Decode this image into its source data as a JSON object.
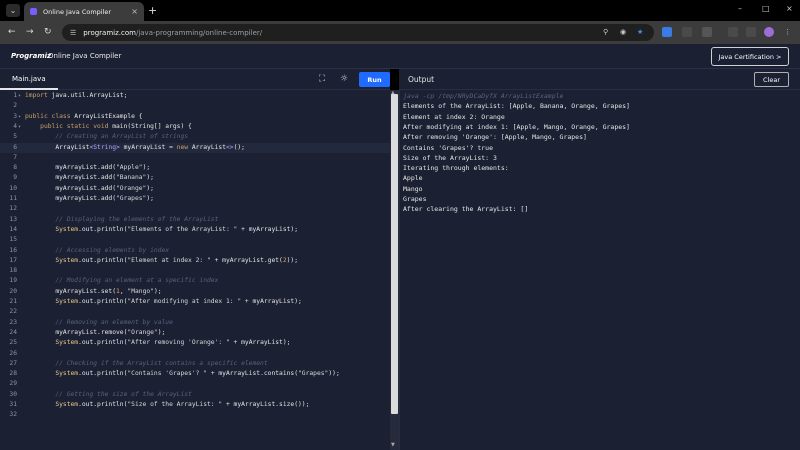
{
  "browser": {
    "tab_title": "Online Java Compiler",
    "url_host": "programiz.com",
    "url_path": "/java-programming/online-compiler/"
  },
  "site": {
    "logo_text": "Programiz",
    "title": "Online Java Compiler",
    "cert_button": "Java Certification >"
  },
  "editor": {
    "file_tab": "Main.java",
    "run_label": "Run",
    "active_line": 6,
    "lines": [
      {
        "n": "1",
        "fold": "▾",
        "html": "<span class=\"kw\">import</span> <span class=\"pl\">java.util.ArrayList;</span>"
      },
      {
        "n": "2",
        "fold": "",
        "html": ""
      },
      {
        "n": "3",
        "fold": "▾",
        "html": "<span class=\"kw\">public class</span> <span class=\"pl\">ArrayListExample {</span>"
      },
      {
        "n": "4",
        "fold": "▾",
        "html": "    <span class=\"kw\">public static void</span> <span class=\"fn\">main</span><span class=\"pl\">(String[] args) {</span>"
      },
      {
        "n": "5",
        "fold": "",
        "html": "        <span class=\"cm\">// Creating an ArrayList of strings</span>"
      },
      {
        "n": "6",
        "fold": "",
        "html": "        <span class=\"pl\">ArrayList</span><span class=\"ty\">&lt;String&gt;</span> <span class=\"pl\">myArrayList = </span><span class=\"kw\">new</span> <span class=\"pl\">ArrayList</span><span class=\"ty\">&lt;&gt;</span><span class=\"pl\">();</span>"
      },
      {
        "n": "7",
        "fold": "",
        "html": ""
      },
      {
        "n": "8",
        "fold": "",
        "html": "        <span class=\"pl\">myArrayList.add(</span><span class=\"str\">\"Apple\"</span><span class=\"pl\">);</span>"
      },
      {
        "n": "9",
        "fold": "",
        "html": "        <span class=\"pl\">myArrayList.add(</span><span class=\"str\">\"Banana\"</span><span class=\"pl\">);</span>"
      },
      {
        "n": "10",
        "fold": "",
        "html": "        <span class=\"pl\">myArrayList.add(</span><span class=\"str\">\"Orange\"</span><span class=\"pl\">);</span>"
      },
      {
        "n": "11",
        "fold": "",
        "html": "        <span class=\"pl\">myArrayList.add(</span><span class=\"str\">\"Grapes\"</span><span class=\"pl\">);</span>"
      },
      {
        "n": "12",
        "fold": "",
        "html": ""
      },
      {
        "n": "13",
        "fold": "",
        "html": "        <span class=\"cm\">// Displaying the elements of the ArrayList</span>"
      },
      {
        "n": "14",
        "fold": "",
        "html": "        <span class=\"sysout\">System</span><span class=\"pl\">.out.println(</span><span class=\"str\">\"Elements of the ArrayList: \"</span> <span class=\"pl\">+ myArrayList);</span>"
      },
      {
        "n": "15",
        "fold": "",
        "html": ""
      },
      {
        "n": "16",
        "fold": "",
        "html": "        <span class=\"cm\">// Accessing elements by index</span>"
      },
      {
        "n": "17",
        "fold": "",
        "html": "        <span class=\"sysout\">System</span><span class=\"pl\">.out.println(</span><span class=\"str\">\"Element at index 2: \"</span> <span class=\"pl\">+ myArrayList.get(</span><span class=\"num\">2</span><span class=\"pl\">));</span>"
      },
      {
        "n": "18",
        "fold": "",
        "html": ""
      },
      {
        "n": "19",
        "fold": "",
        "html": "        <span class=\"cm\">// Modifying an element at a specific index</span>"
      },
      {
        "n": "20",
        "fold": "",
        "html": "        <span class=\"pl\">myArrayList.set(</span><span class=\"num\">1</span><span class=\"pl\">, </span><span class=\"str\">\"Mango\"</span><span class=\"pl\">);</span>"
      },
      {
        "n": "21",
        "fold": "",
        "html": "        <span class=\"sysout\">System</span><span class=\"pl\">.out.println(</span><span class=\"str\">\"After modifying at index 1: \"</span> <span class=\"pl\">+ myArrayList);</span>"
      },
      {
        "n": "22",
        "fold": "",
        "html": ""
      },
      {
        "n": "23",
        "fold": "",
        "html": "        <span class=\"cm\">// Removing an element by value</span>"
      },
      {
        "n": "24",
        "fold": "",
        "html": "        <span class=\"pl\">myArrayList.remove(</span><span class=\"str\">\"Orange\"</span><span class=\"pl\">);</span>"
      },
      {
        "n": "25",
        "fold": "",
        "html": "        <span class=\"sysout\">System</span><span class=\"pl\">.out.println(</span><span class=\"str\">\"After removing 'Orange': \"</span> <span class=\"pl\">+ myArrayList);</span>"
      },
      {
        "n": "26",
        "fold": "",
        "html": ""
      },
      {
        "n": "27",
        "fold": "",
        "html": "        <span class=\"cm\">// Checking if the ArrayList contains a specific element</span>"
      },
      {
        "n": "28",
        "fold": "",
        "html": "        <span class=\"sysout\">System</span><span class=\"pl\">.out.println(</span><span class=\"str\">\"Contains 'Grapes'? \"</span> <span class=\"pl\">+ myArrayList.contains(</span><span class=\"str\">\"Grapes\"</span><span class=\"pl\">));</span>"
      },
      {
        "n": "29",
        "fold": "",
        "html": ""
      },
      {
        "n": "30",
        "fold": "",
        "html": "        <span class=\"cm\">// Getting the size of the ArrayList</span>"
      },
      {
        "n": "31",
        "fold": "",
        "html": "        <span class=\"sysout\">System</span><span class=\"pl\">.out.println(</span><span class=\"str\">\"Size of the ArrayList: \"</span> <span class=\"pl\">+ myArrayList.size());</span>"
      },
      {
        "n": "32",
        "fold": "",
        "html": ""
      }
    ]
  },
  "output": {
    "title": "Output",
    "clear_label": "Clear",
    "command": "java -cp /tmp/NRyDCaDyfX ArrayListExample",
    "lines": [
      "Elements of the ArrayList: [Apple, Banana, Orange, Grapes]",
      "Element at index 2: Orange",
      "After modifying at index 1: [Apple, Mango, Orange, Grapes]",
      "After removing 'Orange': [Apple, Mango, Grapes]",
      "Contains 'Grapes'? true",
      "Size of the ArrayList: 3",
      "Iterating through elements:",
      "Apple",
      "Mango",
      "Grapes",
      "After clearing the ArrayList: []"
    ]
  },
  "colors": {
    "accent": "#1f6bff",
    "editor_bg": "#1b2032",
    "header_bg": "#1c2033"
  }
}
